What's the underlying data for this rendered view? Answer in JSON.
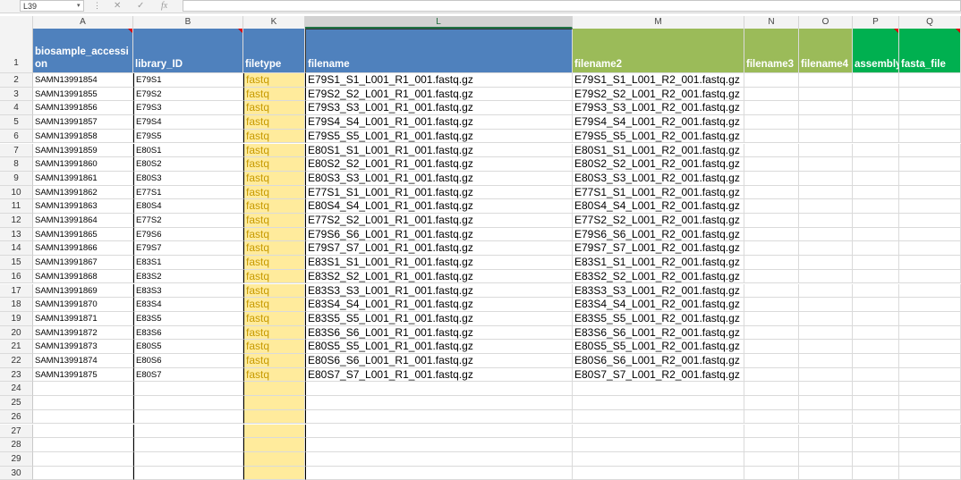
{
  "formula_bar": {
    "name_box": "L39",
    "cancel_icon": "✕",
    "enter_icon": "✓",
    "fx_icon": "fx",
    "formula": ""
  },
  "columns": [
    "A",
    "B",
    "K",
    "L",
    "M",
    "N",
    "O",
    "P",
    "Q"
  ],
  "selected_column": "L",
  "header": {
    "row_number": "1",
    "A": "biosample_accession",
    "B": "library_ID",
    "K": "filetype",
    "L": "filename",
    "M": "filename2",
    "N": "filename3",
    "O": "filename4",
    "P": "assembly",
    "Q": "fasta_file"
  },
  "header_colors": {
    "A": "#4f81bd",
    "B": "#4f81bd",
    "K": "#4f81bd",
    "L": "#4f81bd",
    "M": "#9bbb59",
    "N": "#9bbb59",
    "O": "#9bbb59",
    "P": "#00b050",
    "Q": "#00b050"
  },
  "filetype_fill": "#ffeb9c",
  "rows": [
    {
      "n": "2",
      "A": "SAMN13991854",
      "B": "E79S1",
      "K": "fastq",
      "L": "E79S1_S1_L001_R1_001.fastq.gz",
      "M": "E79S1_S1_L001_R2_001.fastq.gz"
    },
    {
      "n": "3",
      "A": "SAMN13991855",
      "B": "E79S2",
      "K": "fastq",
      "L": "E79S2_S2_L001_R1_001.fastq.gz",
      "M": "E79S2_S2_L001_R2_001.fastq.gz"
    },
    {
      "n": "4",
      "A": "SAMN13991856",
      "B": "E79S3",
      "K": "fastq",
      "L": "E79S3_S3_L001_R1_001.fastq.gz",
      "M": "E79S3_S3_L001_R2_001.fastq.gz"
    },
    {
      "n": "5",
      "A": "SAMN13991857",
      "B": "E79S4",
      "K": "fastq",
      "L": "E79S4_S4_L001_R1_001.fastq.gz",
      "M": "E79S4_S4_L001_R2_001.fastq.gz"
    },
    {
      "n": "6",
      "A": "SAMN13991858",
      "B": "E79S5",
      "K": "fastq",
      "L": "E79S5_S5_L001_R1_001.fastq.gz",
      "M": "E79S5_S5_L001_R2_001.fastq.gz"
    },
    {
      "n": "7",
      "A": "SAMN13991859",
      "B": "E80S1",
      "K": "fastq",
      "L": "E80S1_S1_L001_R1_001.fastq.gz",
      "M": "E80S1_S1_L001_R2_001.fastq.gz"
    },
    {
      "n": "8",
      "A": "SAMN13991860",
      "B": "E80S2",
      "K": "fastq",
      "L": "E80S2_S2_L001_R1_001.fastq.gz",
      "M": "E80S2_S2_L001_R2_001.fastq.gz"
    },
    {
      "n": "9",
      "A": "SAMN13991861",
      "B": "E80S3",
      "K": "fastq",
      "L": "E80S3_S3_L001_R1_001.fastq.gz",
      "M": "E80S3_S3_L001_R2_001.fastq.gz"
    },
    {
      "n": "10",
      "A": "SAMN13991862",
      "B": "E77S1",
      "K": "fastq",
      "L": "E77S1_S1_L001_R1_001.fastq.gz",
      "M": "E77S1_S1_L001_R2_001.fastq.gz"
    },
    {
      "n": "11",
      "A": "SAMN13991863",
      "B": "E80S4",
      "K": "fastq",
      "L": "E80S4_S4_L001_R1_001.fastq.gz",
      "M": "E80S4_S4_L001_R2_001.fastq.gz"
    },
    {
      "n": "12",
      "A": "SAMN13991864",
      "B": "E77S2",
      "K": "fastq",
      "L": "E77S2_S2_L001_R1_001.fastq.gz",
      "M": "E77S2_S2_L001_R2_001.fastq.gz"
    },
    {
      "n": "13",
      "A": "SAMN13991865",
      "B": "E79S6",
      "K": "fastq",
      "L": "E79S6_S6_L001_R1_001.fastq.gz",
      "M": "E79S6_S6_L001_R2_001.fastq.gz"
    },
    {
      "n": "14",
      "A": "SAMN13991866",
      "B": "E79S7",
      "K": "fastq",
      "L": "E79S7_S7_L001_R1_001.fastq.gz",
      "M": "E79S7_S7_L001_R2_001.fastq.gz"
    },
    {
      "n": "15",
      "A": "SAMN13991867",
      "B": "E83S1",
      "K": "fastq",
      "L": "E83S1_S1_L001_R1_001.fastq.gz",
      "M": "E83S1_S1_L001_R2_001.fastq.gz"
    },
    {
      "n": "16",
      "A": "SAMN13991868",
      "B": "E83S2",
      "K": "fastq",
      "L": "E83S2_S2_L001_R1_001.fastq.gz",
      "M": "E83S2_S2_L001_R2_001.fastq.gz"
    },
    {
      "n": "17",
      "A": "SAMN13991869",
      "B": "E83S3",
      "K": "fastq",
      "L": "E83S3_S3_L001_R1_001.fastq.gz",
      "M": "E83S3_S3_L001_R2_001.fastq.gz"
    },
    {
      "n": "18",
      "A": "SAMN13991870",
      "B": "E83S4",
      "K": "fastq",
      "L": "E83S4_S4_L001_R1_001.fastq.gz",
      "M": "E83S4_S4_L001_R2_001.fastq.gz"
    },
    {
      "n": "19",
      "A": "SAMN13991871",
      "B": "E83S5",
      "K": "fastq",
      "L": "E83S5_S5_L001_R1_001.fastq.gz",
      "M": "E83S5_S5_L001_R2_001.fastq.gz"
    },
    {
      "n": "20",
      "A": "SAMN13991872",
      "B": "E83S6",
      "K": "fastq",
      "L": "E83S6_S6_L001_R1_001.fastq.gz",
      "M": "E83S6_S6_L001_R2_001.fastq.gz"
    },
    {
      "n": "21",
      "A": "SAMN13991873",
      "B": "E80S5",
      "K": "fastq",
      "L": "E80S5_S5_L001_R1_001.fastq.gz",
      "M": "E80S5_S5_L001_R2_001.fastq.gz"
    },
    {
      "n": "22",
      "A": "SAMN13991874",
      "B": "E80S6",
      "K": "fastq",
      "L": "E80S6_S6_L001_R1_001.fastq.gz",
      "M": "E80S6_S6_L001_R2_001.fastq.gz"
    },
    {
      "n": "23",
      "A": "SAMN13991875",
      "B": "E80S7",
      "K": "fastq",
      "L": "E80S7_S7_L001_R1_001.fastq.gz",
      "M": "E80S7_S7_L001_R2_001.fastq.gz"
    }
  ],
  "empty_rows": [
    "24",
    "25",
    "26",
    "27",
    "28",
    "29",
    "30"
  ]
}
